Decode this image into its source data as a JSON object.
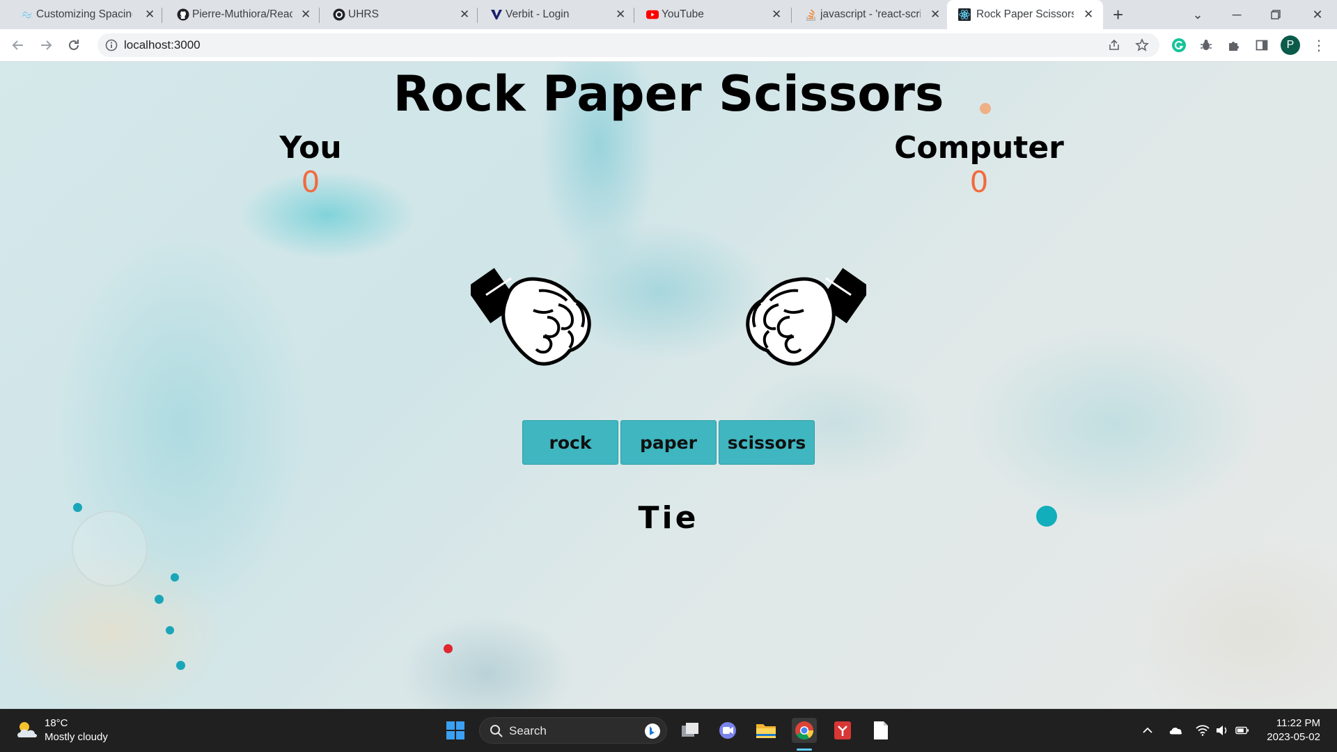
{
  "browser": {
    "tabs": [
      {
        "label": "Customizing Spacing",
        "icon": "tailwind-icon",
        "active": false
      },
      {
        "label": "Pierre-Muthiora/React",
        "icon": "github-icon",
        "active": false
      },
      {
        "label": "UHRS",
        "icon": "uhrs-icon",
        "active": false
      },
      {
        "label": "Verbit - Login",
        "icon": "verbit-icon",
        "active": false
      },
      {
        "label": "YouTube",
        "icon": "youtube-icon",
        "active": false
      },
      {
        "label": "javascript - 'react-scrip",
        "icon": "stackoverflow-icon",
        "active": false
      },
      {
        "label": "Rock Paper Scissors G",
        "icon": "react-icon",
        "active": true
      }
    ],
    "url": "localhost:3000",
    "profile_initial": "P"
  },
  "game": {
    "title": "Rock Paper Scissors",
    "player": {
      "label": "You",
      "score": "0",
      "choice": "rock"
    },
    "computer": {
      "label": "Computer",
      "score": "0",
      "choice": "rock"
    },
    "buttons": {
      "rock": "rock",
      "paper": "paper",
      "scissors": "scissors"
    },
    "result": "Tie",
    "colors": {
      "score": "#f26a3d",
      "button": "#3fb6c0"
    }
  },
  "taskbar": {
    "weather_temp": "18°C",
    "weather_desc": "Mostly cloudy",
    "search_label": "Search",
    "time": "11:22 PM",
    "date": "2023-05-02"
  }
}
